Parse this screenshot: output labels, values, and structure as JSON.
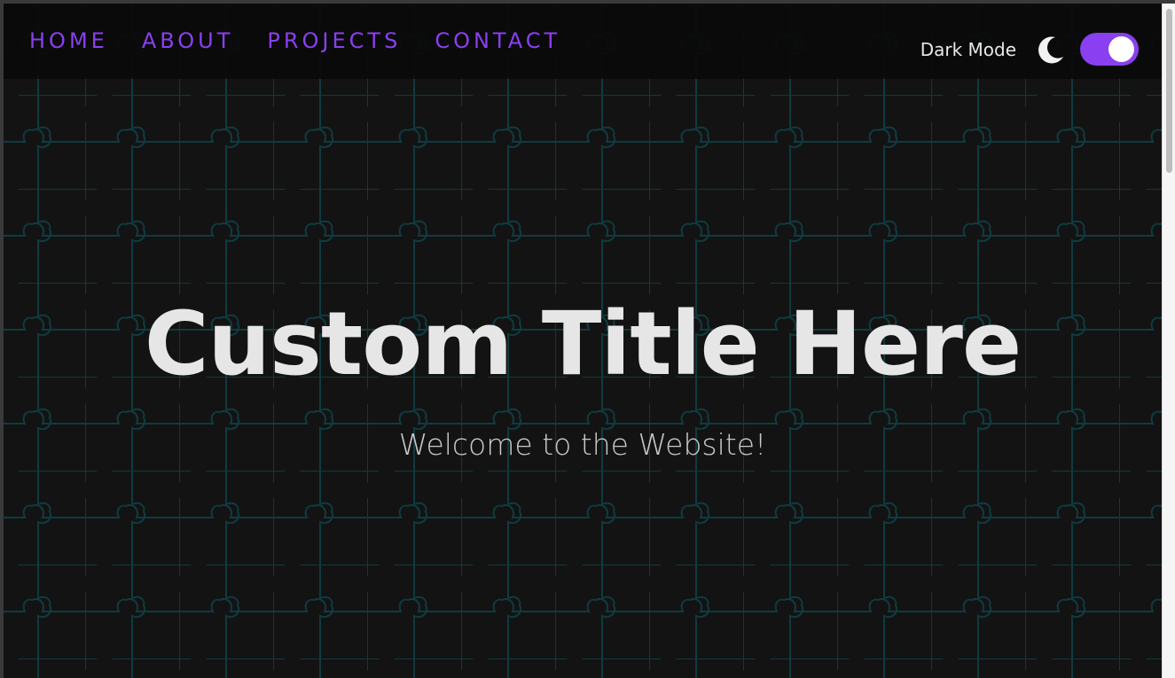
{
  "theme": {
    "accent": "#8a3ff0",
    "puzzle_line": "#0f3b40"
  },
  "nav": {
    "items": [
      {
        "label": "HOME"
      },
      {
        "label": "ABOUT"
      },
      {
        "label": "PROJECTS"
      },
      {
        "label": "CONTACT"
      }
    ]
  },
  "theme_toggle": {
    "label": "Dark Mode",
    "icon": "moon-icon",
    "enabled": true
  },
  "hero": {
    "title": "Custom Title Here",
    "subtitle": "Welcome to the Website!"
  }
}
